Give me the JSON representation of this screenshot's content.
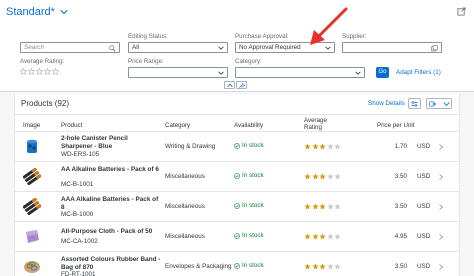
{
  "header": {
    "title": "Standard*",
    "filters": {
      "search": {
        "placeholder": "Search"
      },
      "editing_status": {
        "label": "Editing Status:",
        "value": "All"
      },
      "purchase_approval": {
        "label": "Purchase Approval:",
        "value": "No Approval Required"
      },
      "supplier": {
        "label": "Supplier:",
        "value": ""
      },
      "average_rating": {
        "label": "Average Rating:"
      },
      "price_range": {
        "label": "Price Range:",
        "value": ""
      },
      "category": {
        "label": "Category:",
        "value": ""
      }
    },
    "go_label": "Go",
    "adapt_filters_label": "Adapt Filters (1)"
  },
  "annotation": {
    "arrow_color": "#e8312a"
  },
  "table": {
    "title": "Products (92)",
    "show_details_label": "Show Details",
    "columns": {
      "image": "Image",
      "product": "Product",
      "category": "Category",
      "availability": "Availability",
      "rating_line1": "Average",
      "rating_line2": "Rating",
      "price": "Price per Unit"
    },
    "rows": [
      {
        "name": "2-hole Canister Pencil Sharpener - Blue",
        "id": "WD-ERS-105",
        "category": "Writing & Drawing",
        "availability": "In stock",
        "rating": 3,
        "price": "1.70",
        "currency": "USD",
        "image": "blue-sharpener"
      },
      {
        "name": "AA Alkaline Batteries - Pack of 6",
        "id": "MC-B-1001",
        "category": "Miscellaneous",
        "availability": "In stock",
        "rating": 3,
        "price": "3.50",
        "currency": "USD",
        "image": "batteries"
      },
      {
        "name": "AAA Alkaline Batteries - Pack of 8",
        "id": "MC-B-1000",
        "category": "Miscellaneous",
        "availability": "In stock",
        "rating": 3,
        "price": "3.50",
        "currency": "USD",
        "image": "batteries"
      },
      {
        "name": "All-Purpose Cloth - Pack of 50",
        "id": "MC-CA-1002",
        "category": "Miscellaneous",
        "availability": "In stock",
        "rating": 3,
        "price": "4.95",
        "currency": "USD",
        "image": "cloth"
      },
      {
        "name": "Assorted Colours Rubber Band - Bag of 870",
        "id": "FD-RT-1001",
        "category": "Envelopes & Packaging",
        "availability": "In stock",
        "rating": 3,
        "price": "3.50",
        "currency": "USD",
        "image": "rubber-bands"
      }
    ]
  },
  "colors": {
    "accent": "#0a6ed1",
    "success": "#107e3e",
    "star": "#d6a01d"
  }
}
